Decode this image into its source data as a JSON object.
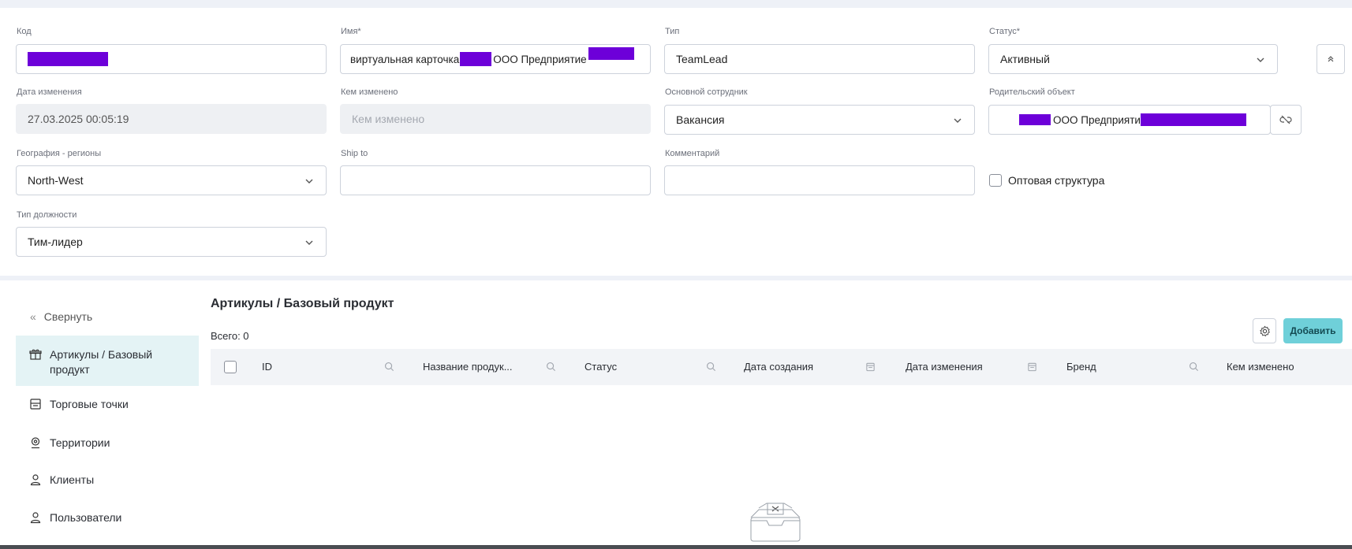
{
  "form": {
    "code": {
      "label": "Код"
    },
    "name": {
      "label": "Имя*",
      "value_pre": "виртуальная карточка",
      "value_mid": "ООО Предприятие"
    },
    "type": {
      "label": "Тип",
      "value": "TeamLead"
    },
    "status": {
      "label": "Статус*",
      "value": "Активный"
    },
    "modified_date": {
      "label": "Дата изменения",
      "value": "27.03.2025 00:05:19"
    },
    "modified_by": {
      "label": "Кем изменено",
      "placeholder": "Кем изменено"
    },
    "main_employee": {
      "label": "Основной сотрудник",
      "value": "Вакансия"
    },
    "parent": {
      "label": "Родительский объект",
      "value_mid": "ООО Предприяти"
    },
    "geography": {
      "label": "География - регионы",
      "value": "North-West"
    },
    "ship_to": {
      "label": "Ship to",
      "value": ""
    },
    "comment": {
      "label": "Комментарий",
      "value": ""
    },
    "wholesale": {
      "label": "Оптовая структура",
      "checked": false
    },
    "position_type": {
      "label": "Тип должности",
      "value": "Тим-лидер"
    }
  },
  "sidebar": {
    "collapse_label": "Свернуть",
    "items": [
      {
        "label": "Артикулы / Базовый продукт",
        "icon": "gift-icon",
        "active": true
      },
      {
        "label": "Торговые точки",
        "icon": "store-icon"
      },
      {
        "label": "Территории",
        "icon": "map-pin-icon"
      },
      {
        "label": "Клиенты",
        "icon": "user-icon"
      },
      {
        "label": "Пользователи",
        "icon": "user-icon"
      }
    ]
  },
  "section": {
    "title": "Артикулы / Базовый продукт",
    "total": "Всего: 0",
    "add_label": "Добавить"
  },
  "table": {
    "columns": [
      {
        "label": "ID",
        "icon": "search-icon"
      },
      {
        "label": "Название продук...",
        "icon": "search-icon"
      },
      {
        "label": "Статус",
        "icon": "search-icon"
      },
      {
        "label": "Дата создания",
        "icon": "calendar-icon"
      },
      {
        "label": "Дата изменения",
        "icon": "calendar-icon"
      },
      {
        "label": "Бренд",
        "icon": "search-icon"
      },
      {
        "label": "Кем изменено",
        "icon": ""
      }
    ],
    "rows": []
  },
  "colors": {
    "accent": "#6fd0d9",
    "active_bg": "#e4f3f5",
    "redaction": "#6d00d9"
  }
}
